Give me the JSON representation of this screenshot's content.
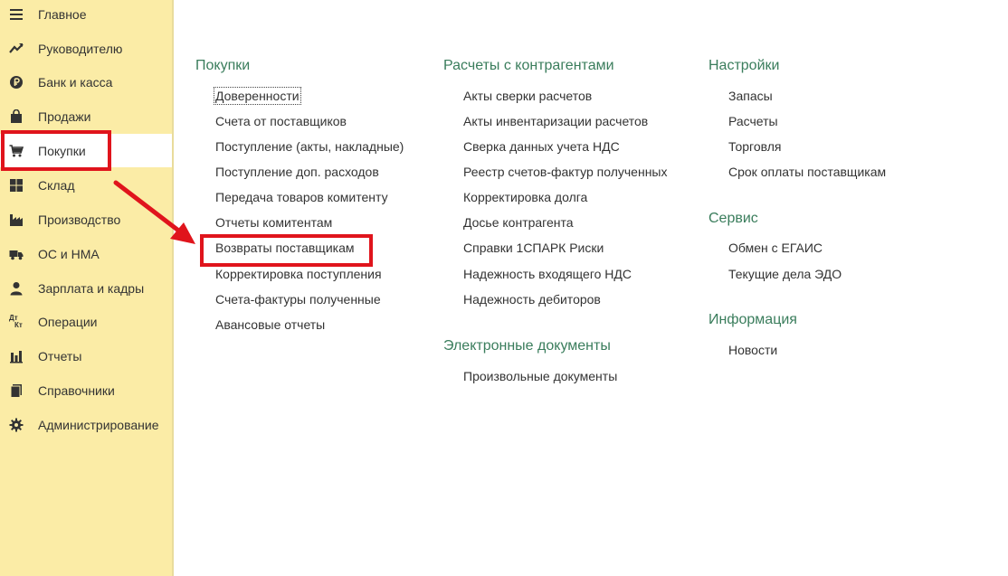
{
  "sidebar": {
    "items": [
      {
        "label": "Главное",
        "icon": "menu-icon"
      },
      {
        "label": "Руководителю",
        "icon": "trend-icon"
      },
      {
        "label": "Банк и касса",
        "icon": "ruble-coin-icon"
      },
      {
        "label": "Продажи",
        "icon": "shopping-bag-icon"
      },
      {
        "label": "Покупки",
        "icon": "cart-icon",
        "active": true
      },
      {
        "label": "Склад",
        "icon": "grid-icon"
      },
      {
        "label": "Производство",
        "icon": "factory-icon"
      },
      {
        "label": "ОС и НМА",
        "icon": "truck-icon"
      },
      {
        "label": "Зарплата и кадры",
        "icon": "person-icon"
      },
      {
        "label": "Операции",
        "icon": "dt-kt-icon"
      },
      {
        "label": "Отчеты",
        "icon": "bar-chart-icon"
      },
      {
        "label": "Справочники",
        "icon": "book-icon"
      },
      {
        "label": "Администрирование",
        "icon": "gear-icon"
      }
    ]
  },
  "dt_kt": {
    "dt": "Дт",
    "kt": "Кт"
  },
  "sections": {
    "purchases": {
      "title": "Покупки",
      "links": [
        "Доверенности",
        "Счета от поставщиков",
        "Поступление (акты, накладные)",
        "Поступление доп. расходов",
        "Передача товаров комитенту",
        "Отчеты комитентам",
        "Возвраты поставщикам",
        "Корректировка поступления",
        "Счета-фактуры полученные",
        "Авансовые отчеты"
      ]
    },
    "settlements": {
      "title": "Расчеты с контрагентами",
      "links": [
        "Акты сверки расчетов",
        "Акты инвентаризации расчетов",
        "Сверка данных учета НДС",
        "Реестр счетов-фактур полученных",
        "Корректировка долга",
        "Досье контрагента",
        "Справки 1СПАРК Риски",
        "Надежность входящего НДС",
        "Надежность дебиторов"
      ]
    },
    "edocs": {
      "title": "Электронные документы",
      "links": [
        "Произвольные документы"
      ]
    },
    "settings": {
      "title": "Настройки",
      "links": [
        "Запасы",
        "Расчеты",
        "Торговля",
        "Срок оплаты поставщикам"
      ]
    },
    "service": {
      "title": "Сервис",
      "links": [
        "Обмен с ЕГАИС",
        "Текущие дела ЭДО"
      ]
    },
    "info": {
      "title": "Информация",
      "links": [
        "Новости"
      ]
    }
  },
  "colors": {
    "sidebar_bg": "#fbeca6",
    "section_title": "#3a7d5c",
    "highlight": "#e0141c"
  }
}
